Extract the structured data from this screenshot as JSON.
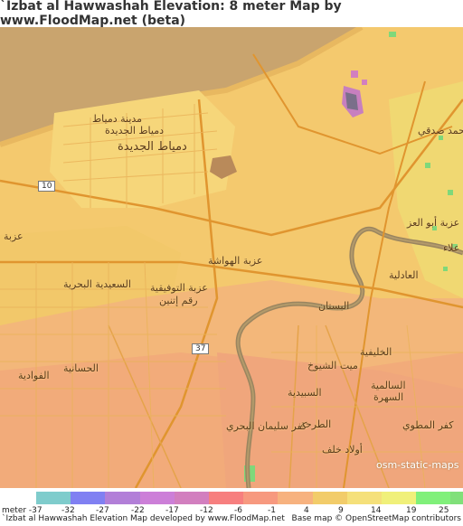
{
  "title": "`Izbat al Hawwashah Elevation: 8 meter Map by www.FloodMap.net (beta)",
  "map": {
    "road_shields": [
      "10",
      "37"
    ],
    "place_labels": {
      "new_damietta_1": "دمياط الجديدة",
      "new_damietta_2": "دمياط الجديدة",
      "new_damietta_3": "مدينة دمياط",
      "hawwasha": "عزبة الهواشة",
      "saeediya": "السعيدية البحرية",
      "tawfiqiya": "عزبة التوفيقية",
      "ragam": "رقم إتنين",
      "ezba_left": "عزبة",
      "bustan": "البستان",
      "adliya": "العادلية",
      "hasaniya": "الحسانية",
      "fawadiya": "الفوادية",
      "mit_shuyukh": "ميت الشيوخ",
      "sabidiya": "السبيدية",
      "kafr_suleiman": "كفر سليمان البحري",
      "turha": "الطرحة",
      "awlad_khalaf": "أولاد خلف",
      "khaliqiya": "الخليفية",
      "salmiya": "السالمية",
      "sahra": "السهرة",
      "kafr_matwi": "كفر المطوي",
      "mohamed_sadiq": "محمد صدقي",
      "ezba_abu_alaa": "عزبة أبو العز",
      "alaa": "علاء"
    },
    "watermark": "osm-static-maps"
  },
  "legend": {
    "colors": [
      "#7fcccc",
      "#8080f2",
      "#b27fd8",
      "#cc7fd8",
      "#d27fbf",
      "#f77f7f",
      "#f7997f",
      "#f7b27f",
      "#f2cc6a",
      "#f5e07a",
      "#f0f07a",
      "#80f07a",
      "#80e07a"
    ],
    "labels": [
      "meter -37",
      "-32",
      "-27",
      "-22",
      "-17",
      "-12",
      "-6",
      "-1",
      "4",
      "9",
      "14",
      "19",
      "25"
    ]
  },
  "footer": {
    "left": "`Izbat al Hawwashah Elevation Map developed by www.FloodMap.net",
    "right": "Base map © OpenStreetMap contributors"
  }
}
